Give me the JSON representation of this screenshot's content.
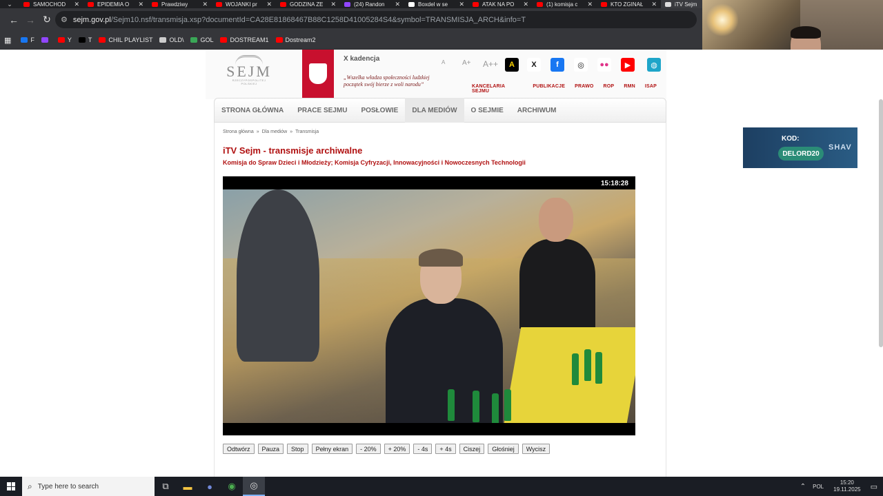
{
  "browser": {
    "tabs": [
      {
        "label": "SAMOCHOD",
        "color": "#ff0000"
      },
      {
        "label": "EPIDEMIA O",
        "color": "#ff0000"
      },
      {
        "label": "Prawdziwy",
        "color": "#ff0000"
      },
      {
        "label": "WOJANKI pr",
        "color": "#ff0000"
      },
      {
        "label": "GODZINA ZE",
        "color": "#ff0000"
      },
      {
        "label": "(24) Randon",
        "color": "#9146ff"
      },
      {
        "label": "Boxdel w se",
        "color": "#ffffff"
      },
      {
        "label": "ATAK NA PO",
        "color": "#ff0000"
      },
      {
        "label": "(1) komisja c",
        "color": "#ff0000"
      },
      {
        "label": "KTO ZGINAŁ",
        "color": "#ff0000"
      },
      {
        "label": "iTV Sejm",
        "color": "#dddddd"
      }
    ],
    "address": {
      "host": "sejm.gov.pl",
      "path": "/Sejm10.nsf/transmisja.xsp?documentId=CA28E81868467B88C1258D41005284S4&symbol=TRANSMISJA_ARCH&info=T"
    },
    "bookmarks": [
      {
        "label": "F",
        "color": "#1877f2"
      },
      {
        "label": "",
        "color": "#9146ff"
      },
      {
        "label": "Y",
        "color": "#ff0000"
      },
      {
        "label": "T",
        "color": "#000000"
      },
      {
        "label": "CHIL PLAYLIST",
        "color": "#ff0000"
      },
      {
        "label": "OLD\\",
        "color": "#cccccc"
      },
      {
        "label": "GOL",
        "color": "#3aa757"
      },
      {
        "label": "DOSTREAM1",
        "color": "#ff0000"
      },
      {
        "label": "Dostream2",
        "color": "#ff0000"
      }
    ]
  },
  "site": {
    "logo_word": "SEJM",
    "logo_sub": "RZECZYPOSPOLITEJ POLSKIEJ",
    "kadencja": "X kadencja",
    "motto": "„Wszelka władza społeczności ludzkiej początek swój bierze z woli narodu”",
    "font_sizes": [
      "A",
      "A+",
      "A++"
    ],
    "social": [
      {
        "name": "a-icon",
        "glyph": "A",
        "bg": "#000000"
      },
      {
        "name": "x-icon",
        "glyph": "X",
        "bg": "#ffffff"
      },
      {
        "name": "facebook-icon",
        "glyph": "f",
        "bg": "#1877f2"
      },
      {
        "name": "instagram-icon",
        "glyph": "◎",
        "bg": "#ffffff"
      },
      {
        "name": "flickr-icon",
        "glyph": "●●",
        "bg": "#ffffff"
      },
      {
        "name": "youtube-icon",
        "glyph": "▶",
        "bg": "#ff0000"
      },
      {
        "name": "sejm-icon",
        "glyph": "◍",
        "bg": "#1ea5c9"
      }
    ],
    "top_links": [
      "KANCELARIA SEJMU",
      "PUBLIKACJE",
      "PRAWO",
      "ROP",
      "RMN",
      "ISAP"
    ],
    "nav": [
      "STRONA GŁÓWNA",
      "PRACE SEJMU",
      "POSŁOWIE",
      "DLA MEDIÓW",
      "O SEJMIE",
      "ARCHIWUM"
    ],
    "nav_active": "DLA MEDIÓW",
    "breadcrumb": [
      "Strona główna",
      "Dla mediów",
      "Transmisja"
    ],
    "title": "iTV Sejm - transmisje archiwalne",
    "subtitle": "Komisja do Spraw Dzieci i Młodzieży; Komisja Cyfryzacji, Innowacyjności i Nowoczesnych Technologii",
    "player_time": "15:18:28",
    "controls": [
      "Odtwórz",
      "Pauza",
      "Stop",
      "Pełny ekran",
      "- 20%",
      "+ 20%",
      "- 4s",
      "+ 4s",
      "Ciszej",
      "Głośniej",
      "Wycisz"
    ]
  },
  "promo": {
    "kod_label": "KOD:",
    "code": "DELORD20",
    "brand": "SHAV"
  },
  "taskbar": {
    "search_placeholder": "Type here to search",
    "lang": "POL",
    "time": "15:20",
    "date": "19.11.2025"
  }
}
